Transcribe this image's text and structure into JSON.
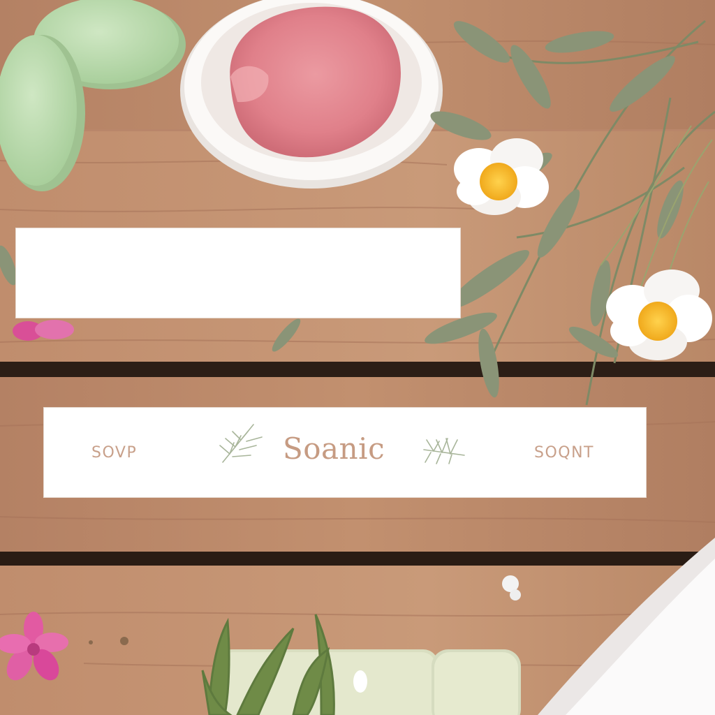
{
  "banner_main": {
    "left_text": "SOVP",
    "title": "Soanic",
    "right_text": "SOQNT"
  },
  "colors": {
    "wood": "#b9866a",
    "banner": "#ffffff",
    "title": "#c69b82",
    "sprig": "#a8b59a"
  },
  "icons": [
    "leaf-sprig-icon",
    "leaf-sprig-icon"
  ]
}
